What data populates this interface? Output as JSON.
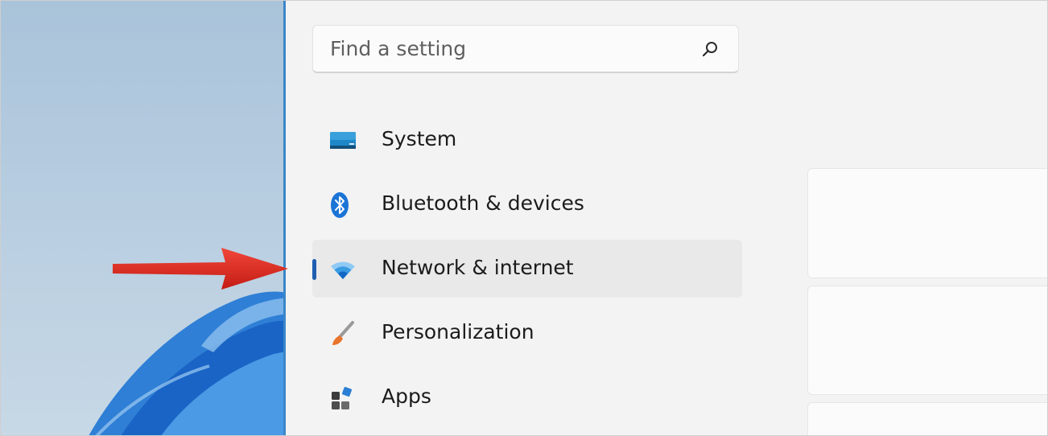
{
  "search": {
    "placeholder": "Find a setting"
  },
  "nav": {
    "items": [
      {
        "label": "System",
        "icon": "monitor-icon",
        "selected": false
      },
      {
        "label": "Bluetooth & devices",
        "icon": "bluetooth-icon",
        "selected": false
      },
      {
        "label": "Network & internet",
        "icon": "wifi-icon",
        "selected": true
      },
      {
        "label": "Personalization",
        "icon": "paintbrush-icon",
        "selected": false
      },
      {
        "label": "Apps",
        "icon": "apps-icon",
        "selected": false
      }
    ]
  },
  "colors": {
    "accent": "#1f5fb0",
    "arrow": "#d8261c",
    "settings_background": "#f3f3f3",
    "selected_item_background": "#e9e9e9"
  }
}
